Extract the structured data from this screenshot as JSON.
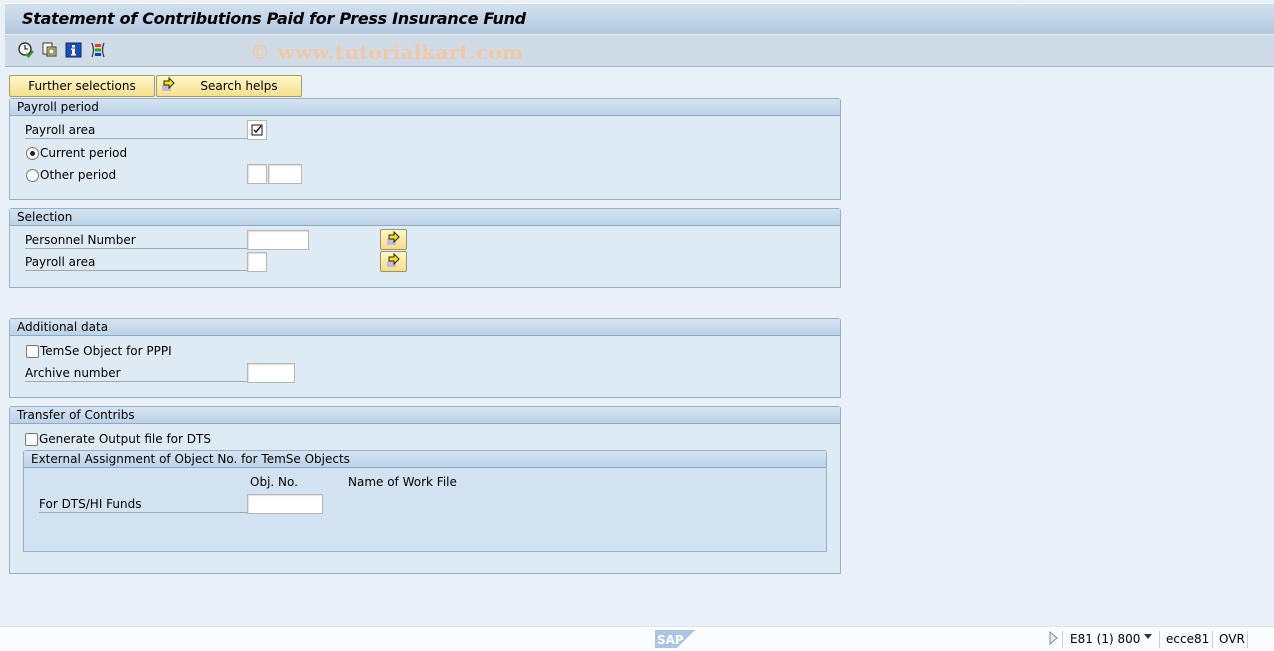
{
  "window": {
    "title": "Statement of Contributions Paid for Press Insurance Fund"
  },
  "toolbar": {
    "icons": [
      "execute-icon",
      "variants-icon",
      "info-icon",
      "selection-options-icon"
    ],
    "watermark": "© www.tutorialkart.com"
  },
  "buttons": {
    "further_selections": "Further selections",
    "search_helps": "Search helps"
  },
  "payroll_period": {
    "title": "Payroll period",
    "payroll_area_label": "Payroll area",
    "payroll_area_checked": true,
    "current_period_label": "Current period",
    "current_period_selected": true,
    "other_period_label": "Other period",
    "other_period_selected": false,
    "other_period_value_1": "",
    "other_period_value_2": ""
  },
  "selection": {
    "title": "Selection",
    "personnel_number_label": "Personnel Number",
    "personnel_number_value": "",
    "payroll_area_label": "Payroll area",
    "payroll_area_value": ""
  },
  "additional_data": {
    "title": "Additional data",
    "temse_label": "TemSe Object for PPPI",
    "temse_checked": false,
    "archive_number_label": "Archive number",
    "archive_number_value": ""
  },
  "transfer": {
    "title": "Transfer of Contribs",
    "generate_output_label": "Generate Output file for DTS",
    "generate_output_checked": false,
    "external": {
      "title": "External Assignment of Object No. for TemSe Objects",
      "col_obj_no": "Obj. No.",
      "col_work_file": "Name of Work File",
      "row_label": "For DTS/HI Funds",
      "obj_no_value": ""
    }
  },
  "status_bar": {
    "logo": "SAP",
    "system": "E81 (1) 800",
    "server": "ecce81",
    "mode": "OVR"
  }
}
